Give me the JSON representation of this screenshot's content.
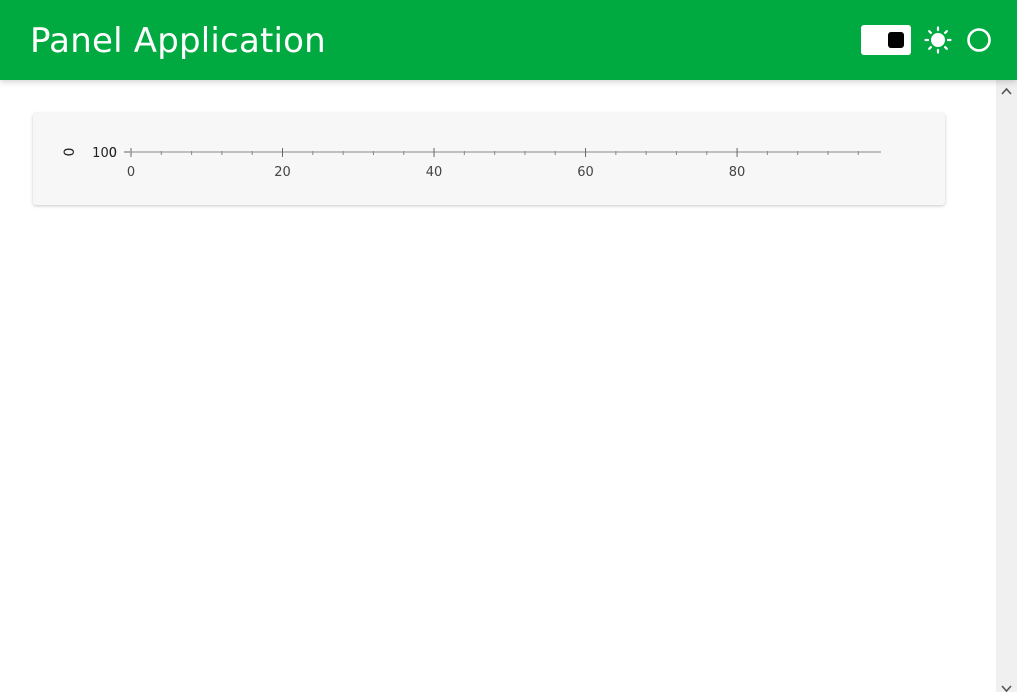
{
  "header": {
    "title": "Panel Application",
    "background_color": "#00aa41",
    "icons": [
      "theme-toggle",
      "sun-icon",
      "circle-icon"
    ]
  },
  "chart_data": {
    "type": "line",
    "title": "",
    "xlabel": "",
    "ylabel": "",
    "x_ticks": [
      "0",
      "20",
      "40",
      "60",
      "80"
    ],
    "xlim": [
      0,
      99
    ],
    "y_ticks": [
      "100",
      "0"
    ],
    "series": [],
    "grid": false,
    "legend": "none"
  }
}
